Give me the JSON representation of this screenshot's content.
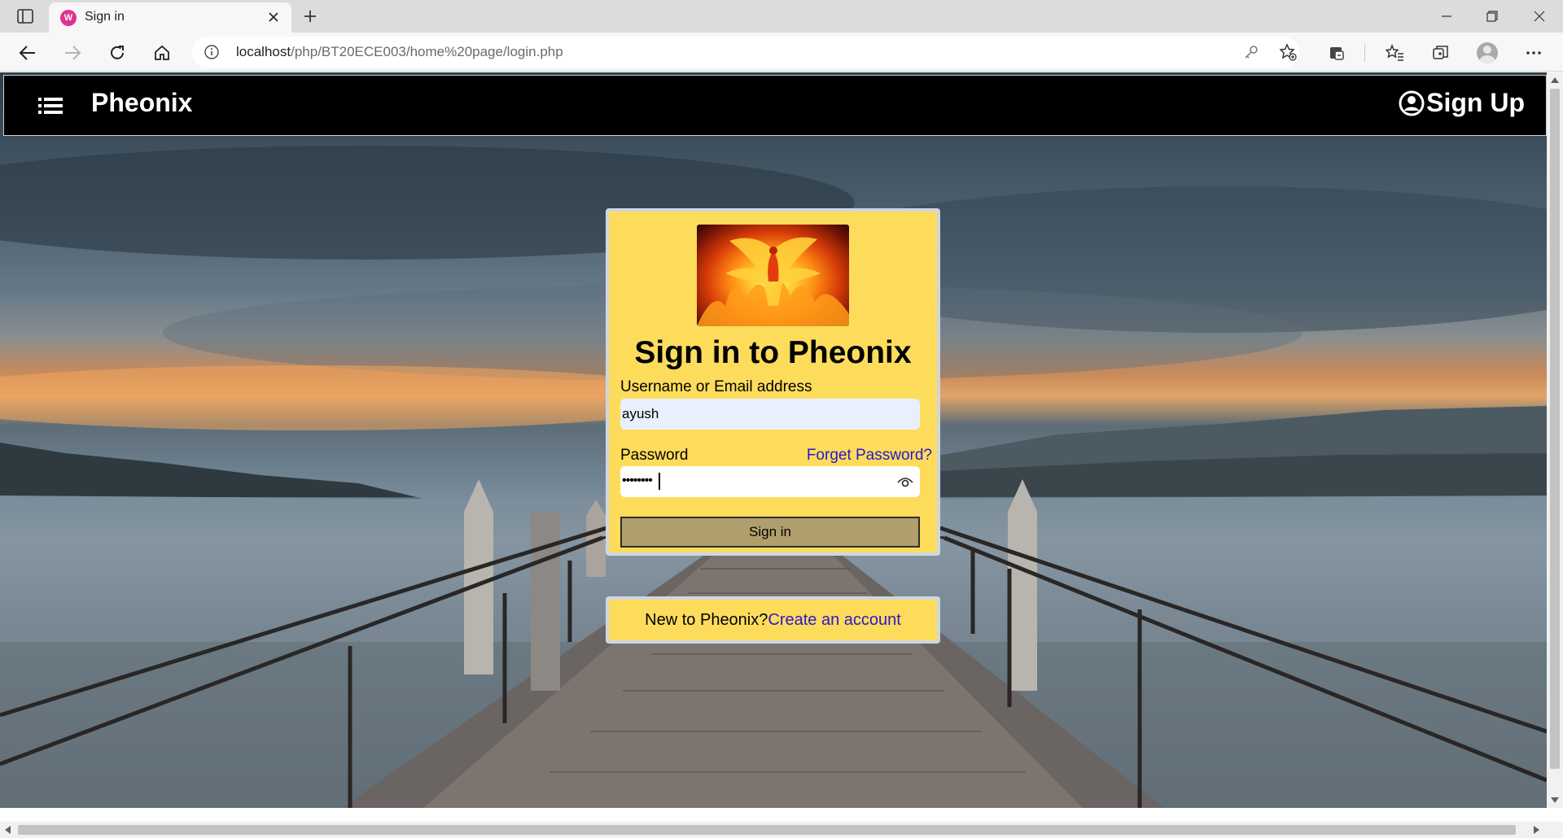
{
  "browser": {
    "tab_title": "Sign in",
    "tab_favicon_text": "W",
    "url_host": "localhost",
    "url_path": "/php/BT20ECE003/home%20page/login.php"
  },
  "navbar": {
    "brand": "Pheonix",
    "signup_label": "Sign Up"
  },
  "login": {
    "title": "Sign in to Pheonix",
    "username_label": "Username or Email address",
    "username_value": "ayush",
    "password_label": "Password",
    "forget_label": "Forget Password?",
    "password_masked": "••••••••",
    "signin_label": "Sign in"
  },
  "register": {
    "prompt": "New to Pheonix?",
    "link": "Create an account"
  },
  "colors": {
    "card_bg": "#fddc5c",
    "link": "#2b18c8",
    "button_bg": "#b09e6c",
    "navbar_bg": "#000000"
  }
}
